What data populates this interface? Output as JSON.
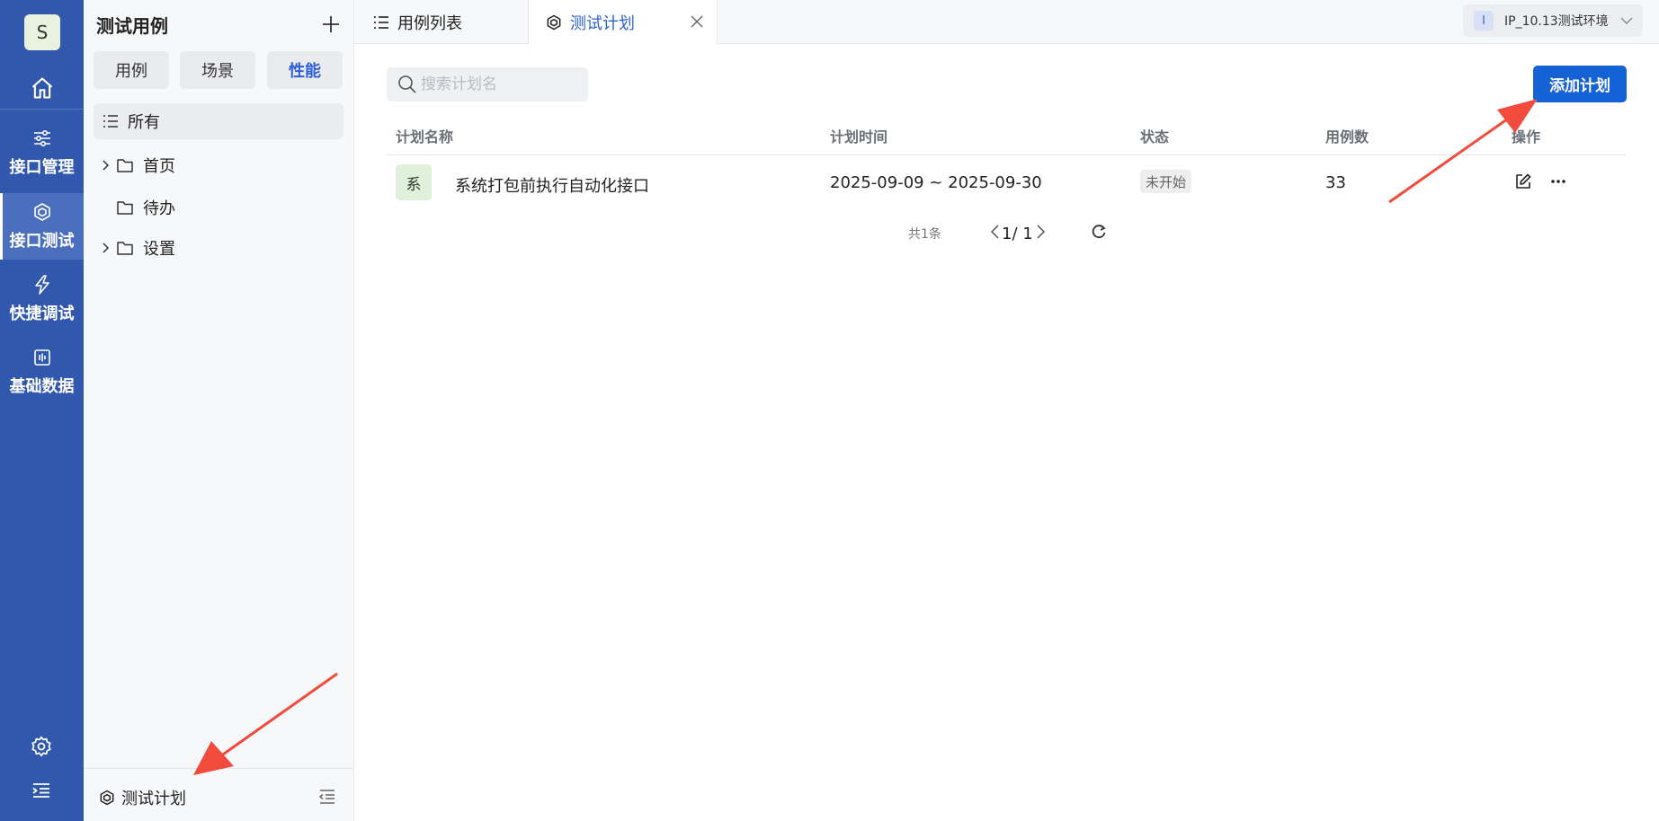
{
  "rail": {
    "avatar": "S",
    "items": [
      {
        "label": "接口管理",
        "icon": "sliders-icon"
      },
      {
        "label": "接口测试",
        "icon": "cube-icon",
        "active": true
      },
      {
        "label": "快捷调试",
        "icon": "lightning-icon"
      },
      {
        "label": "基础数据",
        "icon": "data-icon"
      }
    ]
  },
  "sidebar": {
    "title": "测试用例",
    "segments": [
      {
        "label": "用例"
      },
      {
        "label": "场景"
      },
      {
        "label": "性能",
        "active": true
      }
    ],
    "tree": {
      "all_label": "所有",
      "items": [
        {
          "label": "首页",
          "expandable": true
        },
        {
          "label": "待办",
          "expandable": false
        },
        {
          "label": "设置",
          "expandable": true
        }
      ]
    },
    "footer_label": "测试计划"
  },
  "tabs": [
    {
      "label": "用例列表",
      "active": false
    },
    {
      "label": "测试计划",
      "active": true
    }
  ],
  "environment": {
    "badge": "I",
    "label": "IP_10.13测试环境"
  },
  "main": {
    "search_placeholder": "搜索计划名",
    "add_button": "添加计划",
    "columns": {
      "name": "计划名称",
      "time": "计划时间",
      "status": "状态",
      "cases": "用例数",
      "actions": "操作"
    },
    "rows": [
      {
        "avatar": "系",
        "name": "系统打包前执行自动化接口",
        "time": "2025-09-09 ~ 2025-09-30",
        "status": "未开始",
        "cases": "33"
      }
    ],
    "pagination": {
      "total": "共1条",
      "current": "1/ 1"
    }
  },
  "colors": {
    "rail_bg": "#3158ad",
    "primary": "#1562d6",
    "accent_text": "#2f5fd8",
    "arrow": "#f04b3c"
  }
}
